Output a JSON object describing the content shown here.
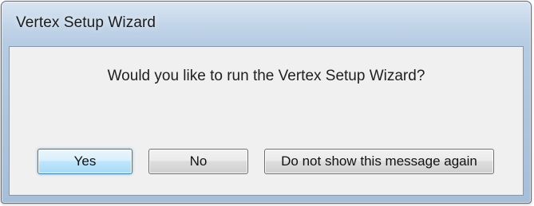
{
  "window": {
    "title": "Vertex Setup Wizard"
  },
  "dialog": {
    "message": "Would you like to run the Vertex Setup Wizard?"
  },
  "buttons": {
    "yes_label": "Yes",
    "no_label": "No",
    "never_label": "Do not show this message again"
  },
  "colors": {
    "frame": "#aec5de",
    "client_background": "#f0f0f0",
    "default_button": "#bee6fd"
  }
}
